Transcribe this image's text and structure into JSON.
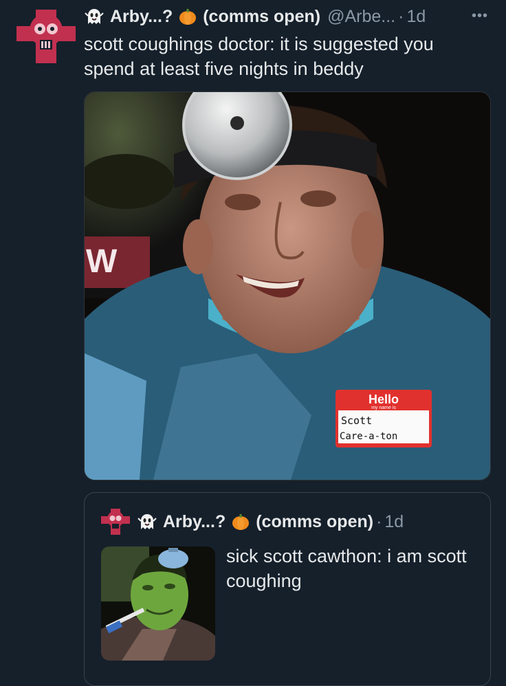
{
  "tweet": {
    "author_name": "Arby...?",
    "author_suffix": "(comms open)",
    "handle": "@Arbe...",
    "separator": "·",
    "time": "1d",
    "more_label": "•••",
    "text": "scott coughings doctor: it is suggested you spend at least five nights in beddy",
    "photo": {
      "sign_text": "W",
      "name_tag": {
        "hello": "Hello",
        "my_name_is": "my name is",
        "line1": "Scott",
        "line2": "Care-a-ton"
      }
    }
  },
  "quote": {
    "author_name": "Arby...?",
    "author_suffix": "(comms open)",
    "separator": "·",
    "time": "1d",
    "text": "sick scott cawthon: i am scott coughing"
  },
  "colors": {
    "background": "#15202b",
    "text_primary": "#e7e9ea",
    "text_secondary": "#8b98a5",
    "avatar_accent": "#c2304f"
  },
  "icons": [
    "ghost-icon",
    "pumpkin-icon",
    "more-icon"
  ]
}
